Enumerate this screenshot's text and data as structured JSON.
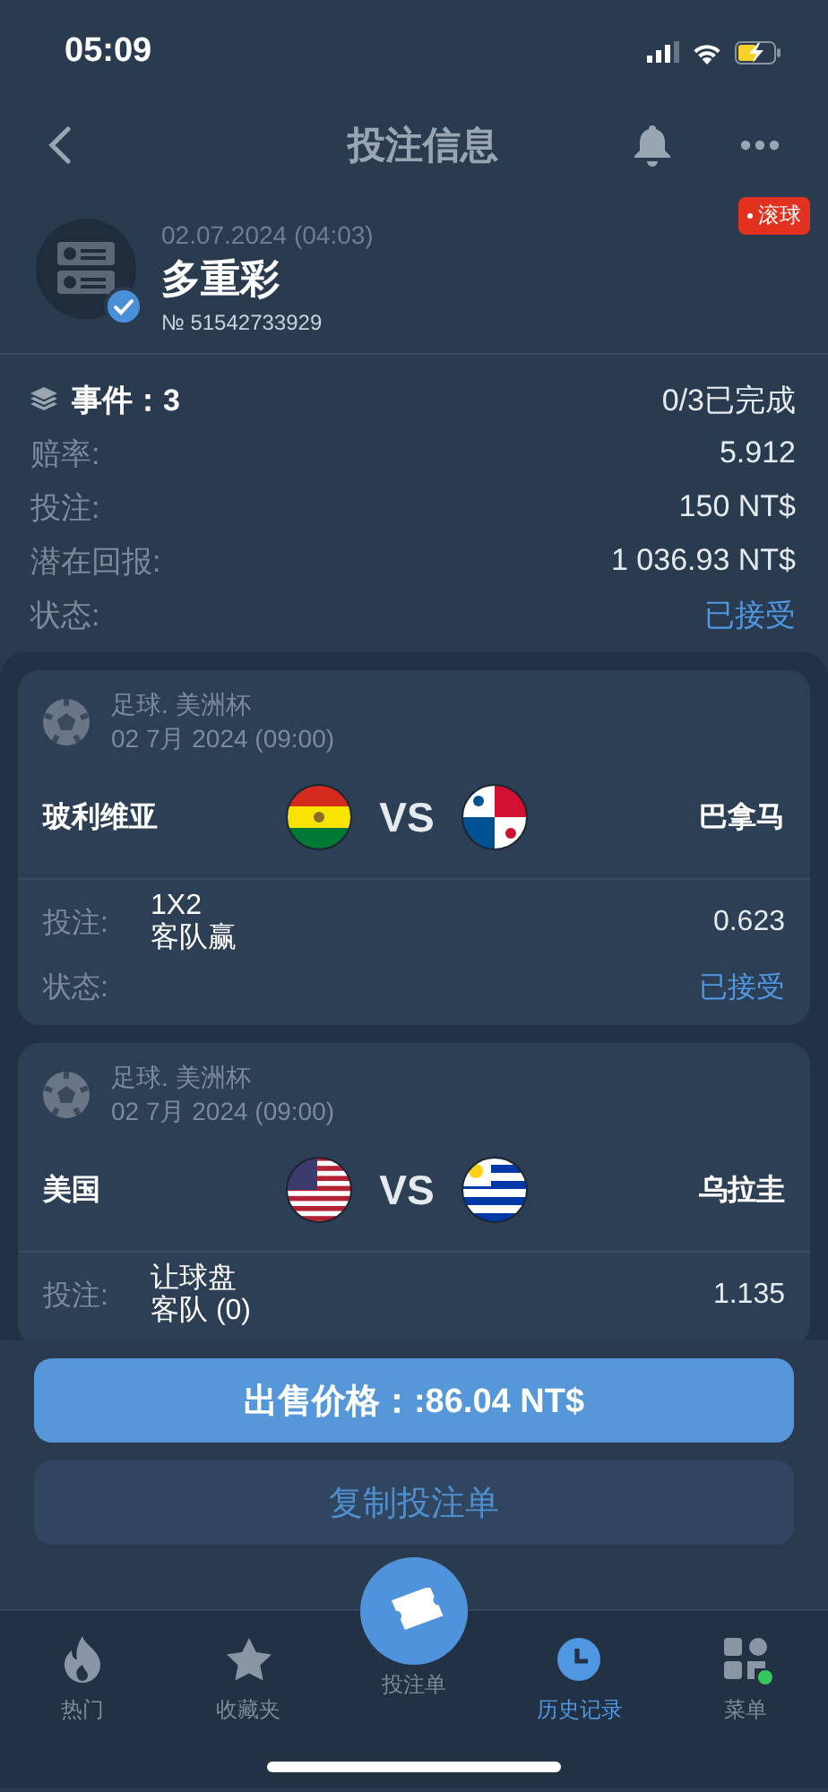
{
  "status_bar": {
    "time": "05:09"
  },
  "nav": {
    "title": "投注信息"
  },
  "bet": {
    "date": "02.07.2024 (04:03)",
    "type": "多重彩",
    "number": "№ 51542733929",
    "badge": "滚球",
    "verified": true
  },
  "summary": {
    "events_label": "事件：3",
    "progress": "0/3已完成",
    "rows": [
      {
        "label": "赔率:",
        "value": "5.912",
        "kind": "plain"
      },
      {
        "label": "投注:",
        "value": "150 NT$",
        "kind": "plain"
      },
      {
        "label": "潜在回报:",
        "value": "1 036.93 NT$",
        "kind": "plain"
      },
      {
        "label": "状态:",
        "value": "已接受",
        "kind": "status"
      }
    ]
  },
  "events": [
    {
      "league": "足球. 美洲杯",
      "date": "02 7月 2024 (09:00)",
      "home": "玻利维亚",
      "vs": "VS",
      "away": "巴拿马",
      "bet_label": "投注:",
      "market": "1X2",
      "pick": "客队赢",
      "odds": "0.623",
      "status_label": "状态:",
      "status": "已接受"
    },
    {
      "league": "足球. 美洲杯",
      "date": "02 7月 2024 (09:00)",
      "home": "美国",
      "vs": "VS",
      "away": "乌拉圭",
      "bet_label": "投注:",
      "market": "让球盘",
      "pick": "客队 (0)",
      "odds": "1.135"
    }
  ],
  "actions": {
    "sell": "出售价格：:86.04 NT$",
    "copy": "复制投注单"
  },
  "tabs": [
    {
      "label": "热门",
      "kind": "hot",
      "selected": false,
      "notification": false
    },
    {
      "label": "收藏夹",
      "kind": "favorites",
      "selected": false,
      "notification": false
    },
    {
      "label": "投注单",
      "kind": "betslip",
      "selected": false,
      "notification": false
    },
    {
      "label": "历史记录",
      "kind": "history",
      "selected": true,
      "notification": false
    },
    {
      "label": "菜单",
      "kind": "menu",
      "selected": false,
      "notification": true
    }
  ]
}
